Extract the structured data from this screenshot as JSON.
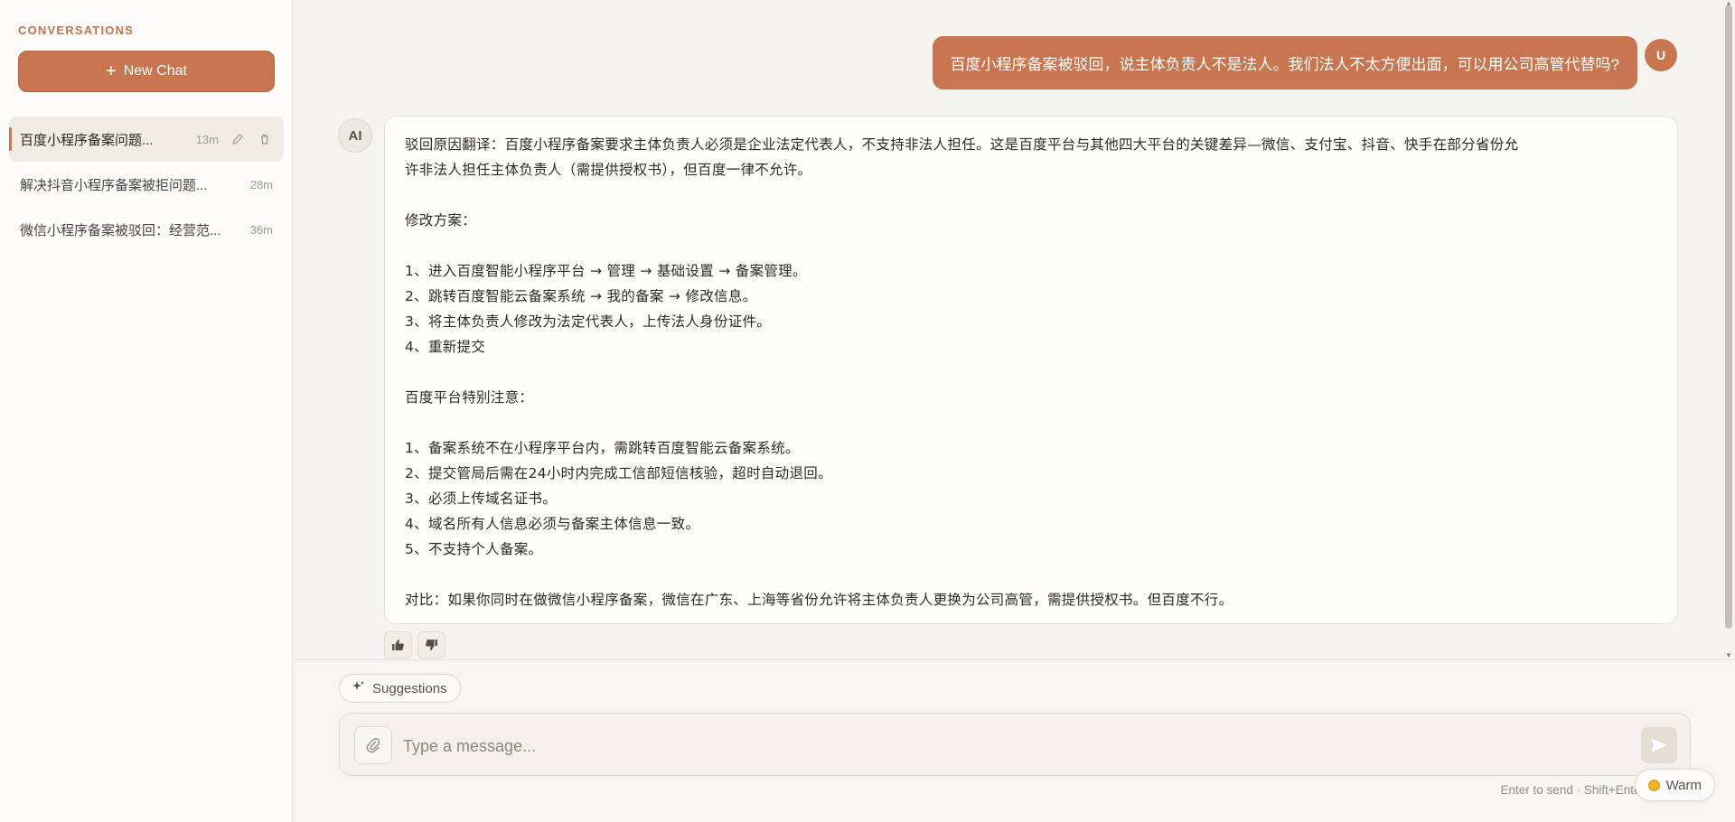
{
  "sidebar": {
    "title": "CONVERSATIONS",
    "new_chat_label": "New Chat",
    "conversations": [
      {
        "title": "百度小程序备案问题...",
        "time": "13m",
        "active": true
      },
      {
        "title": "解决抖音小程序备案被拒问题...",
        "time": "28m",
        "active": false
      },
      {
        "title": "微信小程序备案被驳回：经营范...",
        "time": "36m",
        "active": false
      }
    ]
  },
  "chat": {
    "user_avatar": "U",
    "ai_avatar": "AI",
    "user_message": "百度小程序备案被驳回，说主体负责人不是法人。我们法人不太方便出面，可以用公司高管代替吗?",
    "ai_lines": [
      "驳回原因翻译：百度小程序备案要求主体负责人必须是企业法定代表人，不支持非法人担任。这是百度平台与其他四大平台的关键差异—微信、支付宝、抖音、快手在部分省份允",
      "许非法人担任主体负责人（需提供授权书），但百度一律不允许。",
      "",
      "修改方案：",
      "",
      "1、进入百度智能小程序平台 → 管理 → 基础设置 → 备案管理。",
      "2、跳转百度智能云备案系统 → 我的备案 → 修改信息。",
      "3、将主体负责人修改为法定代表人，上传法人身份证件。",
      "4、重新提交",
      "",
      "百度平台特别注意：",
      "",
      "1、备案系统不在小程序平台内，需跳转百度智能云备案系统。",
      "2、提交管局后需在24小时内完成工信部短信核验，超时自动退回。",
      "3、必须上传域名证书。",
      "4、域名所有人信息必须与备案主体信息一致。",
      "5、不支持个人备案。",
      "",
      "对比：如果你同时在做微信小程序备案，微信在广东、上海等省份允许将主体负责人更换为公司高管，需提供授权书。但百度不行。"
    ]
  },
  "composer": {
    "suggestions_label": "Suggestions",
    "placeholder": "Type a message...",
    "hint": "Enter to send · Shift+Enter",
    "theme_label": "Warm"
  },
  "colors": {
    "accent": "#c97550",
    "background": "#f5f3ef",
    "sidebar": "#fdfcfa"
  },
  "icons": [
    "plus-icon",
    "edit-icon",
    "trash-icon",
    "thumbs-up-icon",
    "thumbs-down-icon",
    "sparkle-icon",
    "paperclip-icon",
    "send-icon",
    "sun-icon"
  ]
}
